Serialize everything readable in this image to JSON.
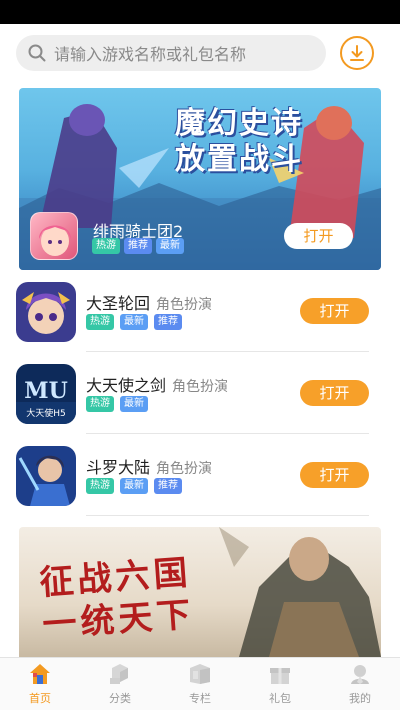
{
  "search": {
    "placeholder": "请输入游戏名称或礼包名称"
  },
  "banner": {
    "title_line1": "魔幻史诗",
    "title_line2": "放置战斗",
    "game_name": "绯雨骑士团2",
    "tags": [
      "热游",
      "推荐",
      "最新"
    ],
    "open_label": "打开"
  },
  "games": [
    {
      "name": "大圣轮回",
      "category": "角色扮演",
      "tags": [
        "热游",
        "最新",
        "推荐"
      ],
      "open_label": "打开"
    },
    {
      "name": "大天使之剑",
      "category": "角色扮演",
      "tags": [
        "热游",
        "最新"
      ],
      "open_label": "打开"
    },
    {
      "name": "斗罗大陆",
      "category": "角色扮演",
      "tags": [
        "热游",
        "最新",
        "推荐"
      ],
      "open_label": "打开"
    }
  ],
  "promo": {
    "slogan_line1": "征战六国",
    "slogan_line2": "一统天下"
  },
  "tabbar": {
    "items": [
      {
        "label": "首页",
        "icon": "home-icon",
        "active": true
      },
      {
        "label": "分类",
        "icon": "category-icon",
        "active": false
      },
      {
        "label": "专栏",
        "icon": "column-icon",
        "active": false
      },
      {
        "label": "礼包",
        "icon": "gift-icon",
        "active": false
      },
      {
        "label": "我的",
        "icon": "profile-icon",
        "active": false
      }
    ]
  },
  "colors": {
    "accent": "#f39a21",
    "hot_tag": "#35c7a6",
    "new_tag": "#5b9ef4"
  }
}
